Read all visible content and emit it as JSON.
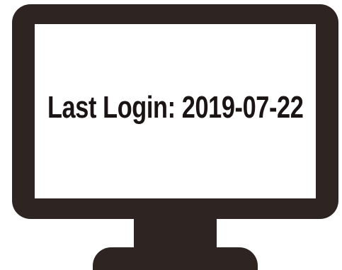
{
  "screen": {
    "message": "Last Login: 2019-07-22"
  },
  "colors": {
    "monitor": "#2e2522",
    "screen": "#ffffff",
    "text": "#1a1414"
  },
  "icon": "monitor-icon"
}
